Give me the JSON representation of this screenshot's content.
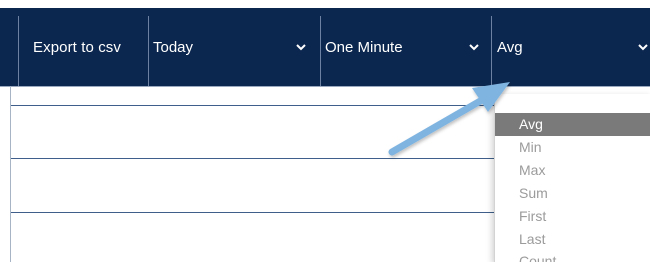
{
  "toolbar": {
    "export_label": "Export to csv",
    "date_range": {
      "value": "Today"
    },
    "interval": {
      "value": "One Minute"
    },
    "aggregation": {
      "value": "Avg"
    }
  },
  "aggregation_menu": {
    "options": [
      "Avg",
      "Min",
      "Max",
      "Sum",
      "First",
      "Last",
      "Count"
    ],
    "selected": "Avg"
  },
  "colors": {
    "toolbar_bg": "#0c274f",
    "menu_selected_bg": "#7a7a7a",
    "menu_text": "#9b9b9b",
    "arrow": "#7fb4e0"
  },
  "icons": [
    "chevron-down-icon",
    "annotation-arrow"
  ]
}
